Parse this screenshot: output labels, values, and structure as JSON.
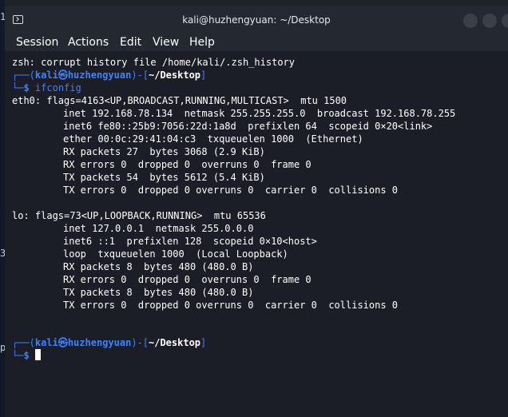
{
  "background": {
    "glyph_1": "1",
    "glyph_2": "3",
    "glyph_3": "p"
  },
  "window": {
    "title": "kali@huzhengyuan: ~/Desktop"
  },
  "menu": [
    "Session",
    "Actions",
    "Edit",
    "View",
    "Help"
  ],
  "terminal": {
    "warning": "zsh: corrupt history file /home/kali/.zsh_history",
    "prompt": {
      "user": "kali",
      "at_glyph": "㉿",
      "host": "huzhengyuan",
      "dir": "~/Desktop",
      "symbol": "$"
    },
    "command": "ifconfig",
    "output": [
      "eth0: flags=4163<UP,BROADCAST,RUNNING,MULTICAST>  mtu 1500",
      "inet 192.168.78.134  netmask 255.255.255.0  broadcast 192.168.78.255",
      "inet6 fe80::25b9:7056:22d:1a8d  prefixlen 64  scopeid 0×20<link>",
      "ether 00:0c:29:41:04:c3  txqueuelen 1000  (Ethernet)",
      "RX packets 27  bytes 3068 (2.9 KiB)",
      "RX errors 0  dropped 0  overruns 0  frame 0",
      "TX packets 54  bytes 5612 (5.4 KiB)",
      "TX errors 0  dropped 0 overruns 0  carrier 0  collisions 0",
      "lo: flags=73<UP,LOOPBACK,RUNNING>  mtu 65536",
      "inet 127.0.0.1  netmask 255.0.0.0",
      "inet6 ::1  prefixlen 128  scopeid 0×10<host>",
      "loop  txqueuelen 1000  (Local Loopback)",
      "RX packets 8  bytes 480 (480.0 B)",
      "RX errors 0  dropped 0  overruns 0  frame 0",
      "TX packets 8  bytes 480 (480.0 B)",
      "TX errors 0  dropped 0 overruns 0  carrier 0  collisions 0"
    ]
  },
  "colors": {
    "accent_blue": "#3e82ff",
    "terminal_bg": "#1b1e26",
    "titlebar_bg": "#242831"
  },
  "icons": {
    "window_icon": "terminal-icon"
  }
}
